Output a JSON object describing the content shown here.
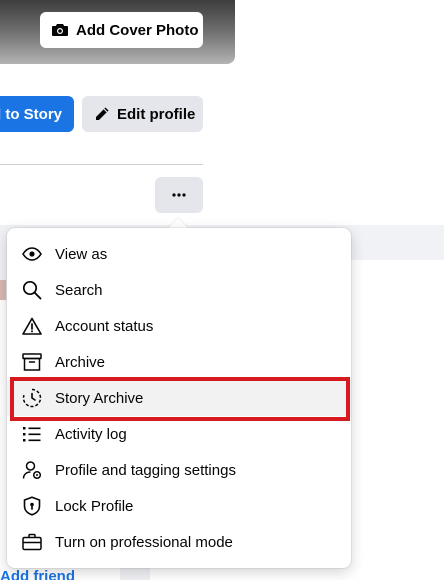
{
  "cover": {
    "button_label": "Add Cover Photo"
  },
  "profile_actions": {
    "add_story_label": "d to Story",
    "edit_profile_label": "Edit profile"
  },
  "menu": {
    "items": [
      {
        "label": "View as",
        "icon": "eye-icon"
      },
      {
        "label": "Search",
        "icon": "search-icon"
      },
      {
        "label": "Account status",
        "icon": "warning-icon"
      },
      {
        "label": "Archive",
        "icon": "archive-icon"
      },
      {
        "label": "Story Archive",
        "icon": "story-archive-icon",
        "highlighted": true
      },
      {
        "label": "Activity log",
        "icon": "list-icon"
      },
      {
        "label": "Profile and tagging settings",
        "icon": "user-gear-icon"
      },
      {
        "label": "Lock Profile",
        "icon": "shield-icon"
      },
      {
        "label": "Turn on professional mode",
        "icon": "briefcase-icon"
      }
    ]
  },
  "background": {
    "add_friend_label": "Add friend"
  },
  "colors": {
    "primary": "#1b74e4",
    "highlight_border": "#d71920",
    "button_gray": "#e4e6eb"
  }
}
